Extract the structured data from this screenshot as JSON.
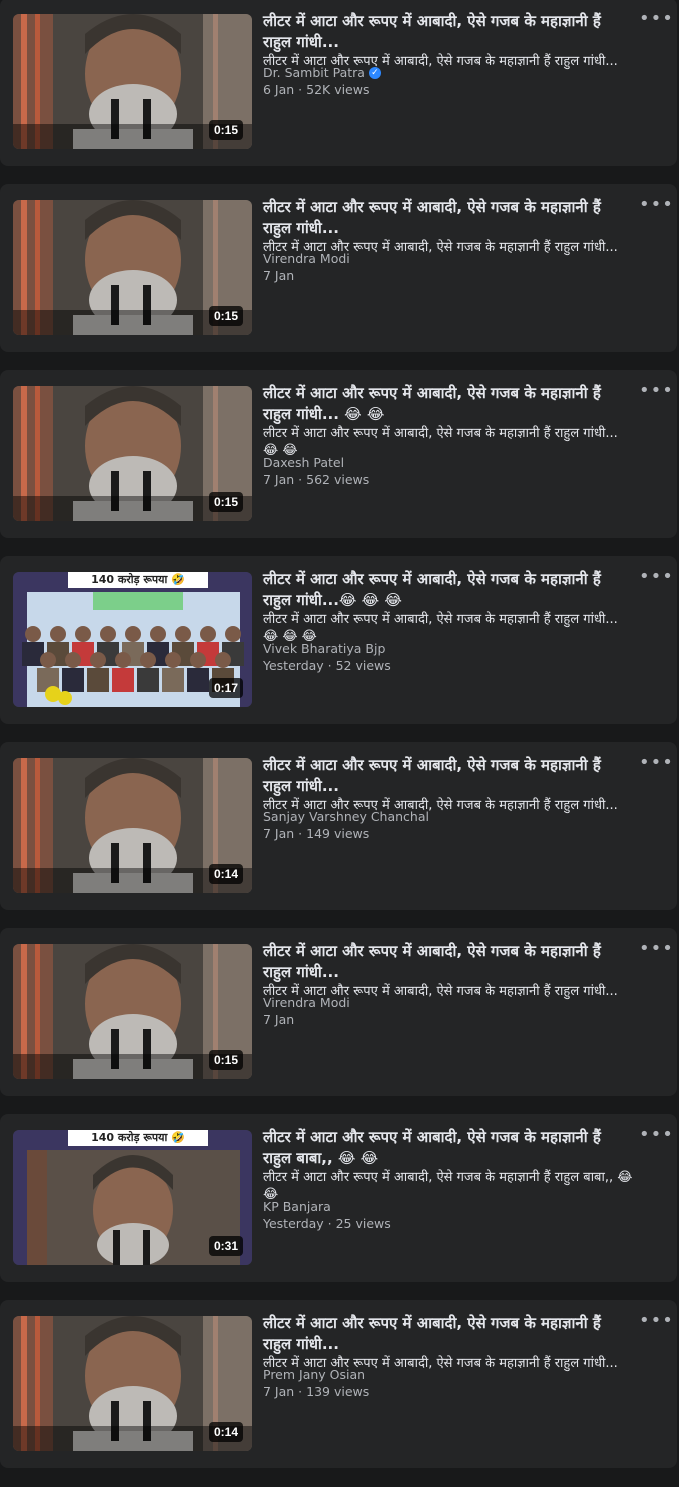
{
  "videos": [
    {
      "title": "लीटर में आटा और रूपए में आबादी, ऐसे गजब के महाज्ञानी हैं राहुल गांधी...",
      "description": "लीटर में आटा और रूपए में आबादी, ऐसे गजब के महाज्ञानी हैं राहुल गांधी...",
      "author": "Dr. Sambit Patra",
      "verified": true,
      "meta": "6 Jan · 52K views",
      "duration": "0:15",
      "thumb_style": "face"
    },
    {
      "title": "लीटर में आटा और रूपए में आबादी, ऐसे गजब के महाज्ञानी हैं राहुल गांधी...",
      "description": "लीटर में आटा और रूपए में आबादी, ऐसे गजब के महाज्ञानी हैं राहुल गांधी...",
      "author": "Virendra Modi",
      "verified": false,
      "meta": "7 Jan",
      "duration": "0:15",
      "thumb_style": "face"
    },
    {
      "title": "लीटर में आटा और रूपए में आबादी, ऐसे गजब के महाज्ञानी हैं राहुल गांधी... 😂 😂",
      "description": "लीटर में आटा और रूपए में आबादी, ऐसे गजब के महाज्ञानी हैं राहुल गांधी... 😂 😂",
      "author": "Daxesh Patel",
      "verified": false,
      "meta": "7 Jan · 562 views",
      "duration": "0:15",
      "thumb_style": "face"
    },
    {
      "title": "लीटर में आटा और रूपए में आबादी, ऐसे गजब के महाज्ञानी हैं राहुल गांधी...😂 😂 😂",
      "description": "लीटर में आटा और रूपए में आबादी, ऐसे गजब के महाज्ञानी हैं राहुल गांधी... 😂 😂 😂",
      "author": "Vivek Bharatiya Bjp",
      "verified": false,
      "meta": "Yesterday · 52 views",
      "duration": "0:17",
      "thumb_style": "crowd",
      "thumb_caption": "140 करोड़ रूपया 🤣"
    },
    {
      "title": "लीटर में आटा और रूपए में आबादी, ऐसे गजब के महाज्ञानी हैं राहुल गांधी...",
      "description": "लीटर में आटा और रूपए में आबादी, ऐसे गजब के महाज्ञानी हैं राहुल गांधी...",
      "author": "Sanjay Varshney Chanchal",
      "verified": false,
      "meta": "7 Jan · 149 views",
      "duration": "0:14",
      "thumb_style": "face"
    },
    {
      "title": "लीटर में आटा और रूपए में आबादी, ऐसे गजब के महाज्ञानी हैं राहुल गांधी...",
      "description": "लीटर में आटा और रूपए में आबादी, ऐसे गजब के महाज्ञानी हैं राहुल गांधी...",
      "author": "Virendra Modi",
      "verified": false,
      "meta": "7 Jan",
      "duration": "0:15",
      "thumb_style": "face"
    },
    {
      "title": "लीटर में आटा और रूपए में आबादी, ऐसे गजब के महाज्ञानी हैं राहुल बाबा,, 😂 😂",
      "description": "लीटर में आटा और रूपए में आबादी, ऐसे गजब के महाज्ञानी हैं राहुल बाबा,, 😂 😂",
      "author": "KP Banjara",
      "verified": false,
      "meta": "Yesterday · 25 views",
      "duration": "0:31",
      "thumb_style": "framed",
      "thumb_caption": "140 करोड़ रूपया 🤣"
    },
    {
      "title": "लीटर में आटा और रूपए में आबादी, ऐसे गजब के महाज्ञानी हैं राहुल गांधी...",
      "description": "लीटर में आटा और रूपए में आबादी, ऐसे गजब के महाज्ञानी हैं राहुल गांधी...",
      "author": "Prem Jany Osian",
      "verified": false,
      "meta": "7 Jan · 139 views",
      "duration": "0:14",
      "thumb_style": "face"
    }
  ],
  "more_label": "•••",
  "colors": {
    "background": "#18191a",
    "card": "#242526",
    "text_primary": "#e4e6eb",
    "text_secondary": "#b0b3b8",
    "verified": "#2d88ff"
  }
}
